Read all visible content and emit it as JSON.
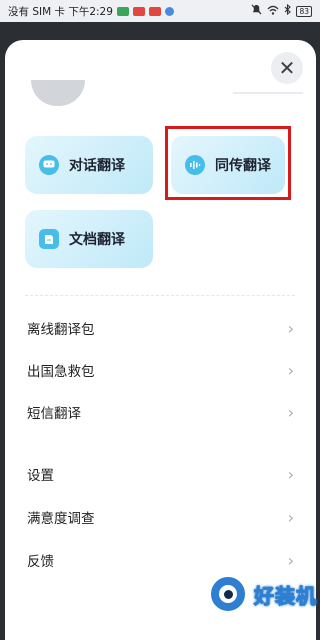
{
  "status_bar": {
    "carrier_time": "没有 SIM 卡 下午2:29",
    "battery": "83",
    "notif_colors": [
      "#3aa55b",
      "#e0473f",
      "#e0473f",
      "#4a8be0"
    ]
  },
  "sheet": {
    "close_glyph": "✕",
    "cards": [
      {
        "label": "对话翻译",
        "icon": "chat-icon"
      },
      {
        "label": "同传翻译",
        "icon": "simultaneous-icon"
      },
      {
        "label": "文档翻译",
        "icon": "document-icon"
      }
    ],
    "menu": [
      {
        "label": "离线翻译包"
      },
      {
        "label": "出国急救包"
      },
      {
        "label": "短信翻译"
      },
      {
        "label": "设置"
      },
      {
        "label": "满意度调查"
      },
      {
        "label": "反馈"
      }
    ],
    "chevron": "›"
  },
  "watermark": {
    "text": "好装机"
  },
  "colors": {
    "accent": "#47bde9",
    "card_gradient_start": "#e4f6fd",
    "card_gradient_end": "#bfe9f8",
    "highlight": "#d51b1b"
  }
}
